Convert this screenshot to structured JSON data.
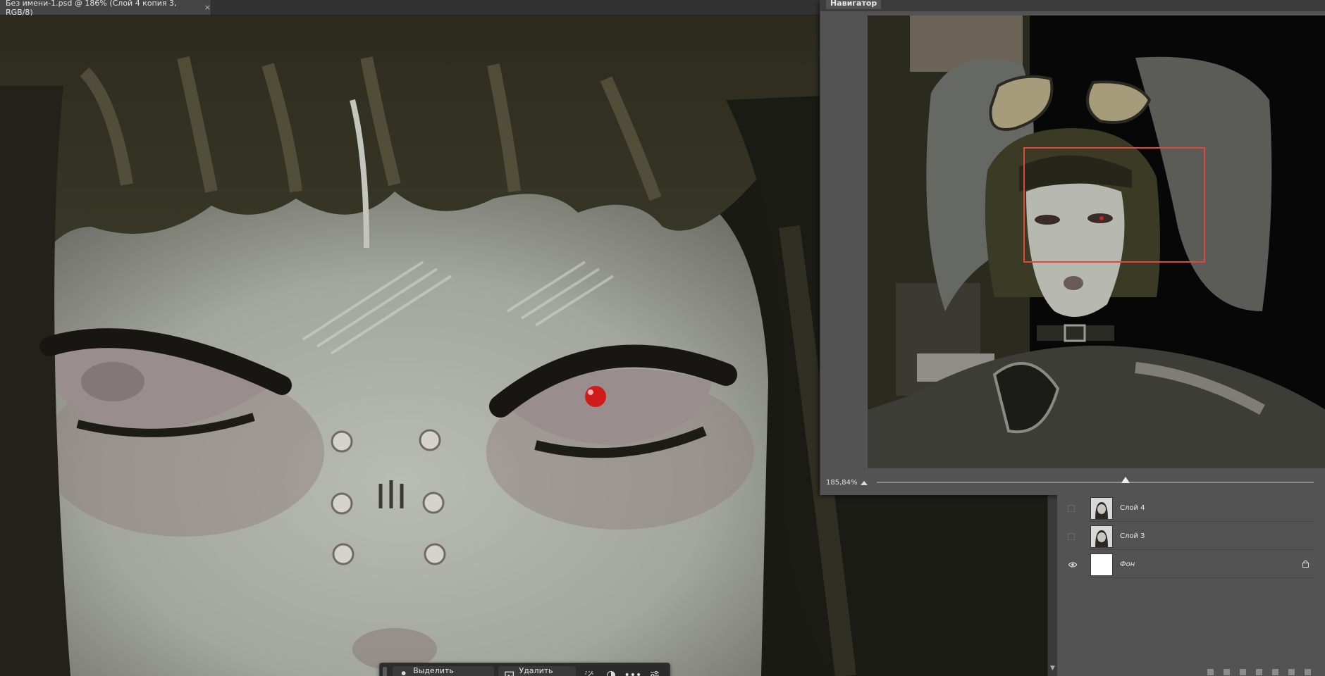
{
  "document_tab": {
    "title": "Без имени-1.psd @ 186% (Слой 4 копия 3, RGB/8)",
    "close_glyph": "×"
  },
  "taskbar": {
    "select_subject_label": "Выделить предмет",
    "remove_bg_label": "Удалить фон",
    "more_glyph": "•••"
  },
  "navigator": {
    "title": "Навигатор",
    "zoom_value": "185,84%",
    "zoom_slider_fraction": 0.57,
    "view_rect_color": "#e3473a"
  },
  "layers": {
    "items": [
      {
        "name": "Слой 4",
        "visible": false,
        "locked": false
      },
      {
        "name": "Слой 3",
        "visible": false,
        "locked": false
      },
      {
        "name": "Фон",
        "visible": true,
        "locked": true
      }
    ]
  },
  "icons": {
    "eye": "eye-icon",
    "lock": "lock-icon",
    "close": "close-icon"
  }
}
